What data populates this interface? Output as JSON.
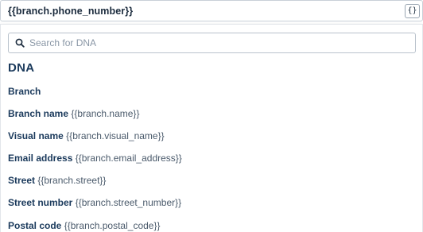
{
  "field": {
    "value": "{{branch.phone_number}}",
    "variable_button_label": "{}"
  },
  "search": {
    "placeholder": "Search for DNA",
    "value": ""
  },
  "dna_title": "DNA",
  "group": {
    "title": "Branch",
    "items": [
      {
        "label": "Branch name",
        "token": "{{branch.name}}"
      },
      {
        "label": "Visual name",
        "token": "{{branch.visual_name}}"
      },
      {
        "label": "Email address",
        "token": "{{branch.email_address}}"
      },
      {
        "label": "Street",
        "token": "{{branch.street}}"
      },
      {
        "label": "Street number",
        "token": "{{branch.street_number}}"
      },
      {
        "label": "Postal code",
        "token": "{{branch.postal_code}}"
      }
    ]
  },
  "colors": {
    "text_primary": "#1b3a5c",
    "border": "#c9d0d8",
    "placeholder": "#8a97a6"
  },
  "icons": {
    "search": "search-icon",
    "variable": "curly-braces-icon"
  }
}
